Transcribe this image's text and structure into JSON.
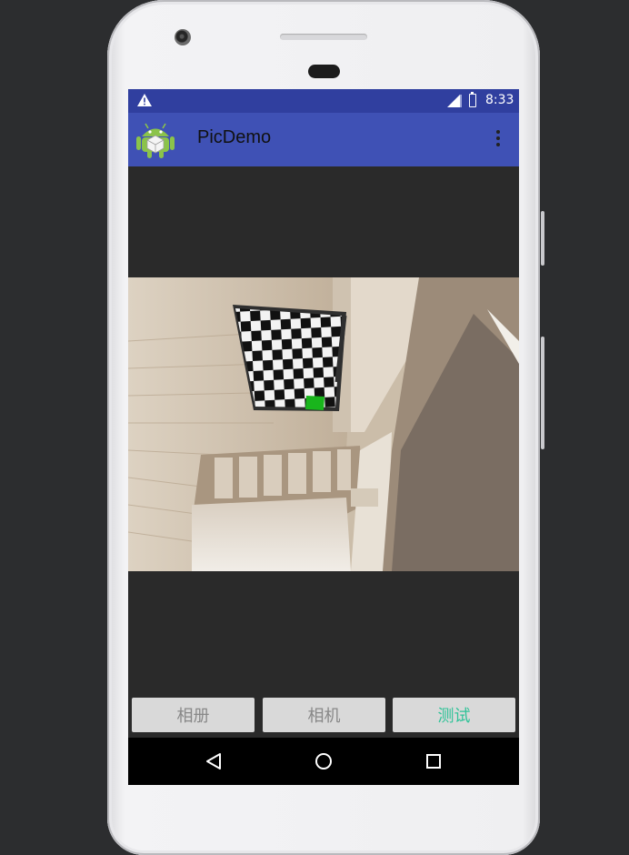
{
  "status_bar": {
    "time": "8:33",
    "left_icon": "warning-icon",
    "icons": [
      "signal-icon",
      "battery-icon"
    ]
  },
  "app_bar": {
    "title": "PicDemo",
    "logo_icon": "android-icon",
    "menu_icon": "more-vert-icon"
  },
  "buttons": [
    {
      "label": "相册",
      "enabled": false
    },
    {
      "label": "相机",
      "enabled": false
    },
    {
      "label": "测试",
      "enabled": true
    }
  ],
  "nav_bar": {
    "icons": [
      "back-icon",
      "home-icon",
      "recents-icon"
    ]
  },
  "colors": {
    "status_bar": "#303f9f",
    "app_bar": "#3f51b5",
    "accent": "#2fc398",
    "screen_bg": "#2a2a2a"
  }
}
